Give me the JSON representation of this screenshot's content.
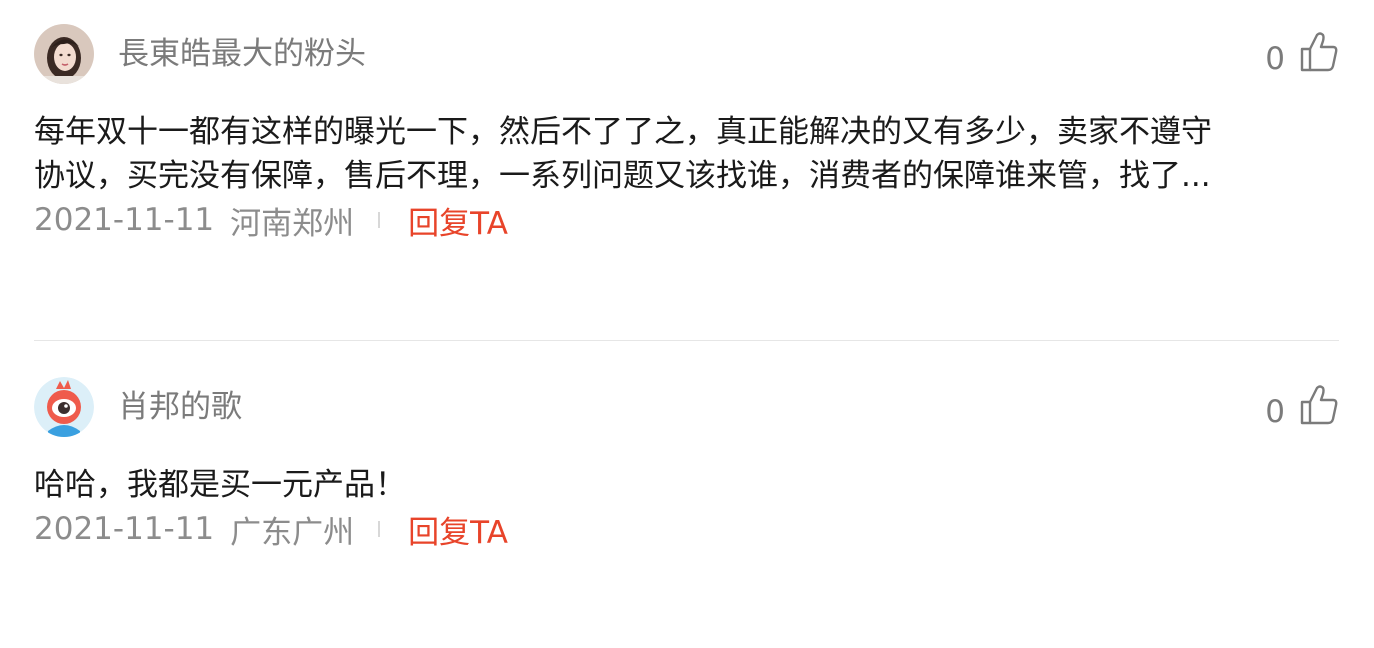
{
  "comments": [
    {
      "username": "長東皓最大的粉头",
      "avatar": "user-photo-avatar",
      "likes": "0",
      "text_line1": "每年双十一都有这样的曝光一下，然后不了了之，真正能解决的又有多少，卖家不遵守",
      "text_line2": "协议，买完没有保障，售后不理，一系列问题又该找谁，消费者的保障谁来管，找了...",
      "date": "2021-11-11",
      "location": "河南郑州",
      "reply_label": "回复TA"
    },
    {
      "username": "肖邦的歌",
      "avatar": "weibo-eye-avatar",
      "likes": "0",
      "text": "哈哈，我都是买一元产品！",
      "date": "2021-11-11",
      "location": "广东广州",
      "reply_label": "回复TA"
    }
  ],
  "colors": {
    "reply": "#e8442a",
    "meta": "#8c8c8c",
    "username": "#7b7b7b",
    "body": "#1a1a1a",
    "divider": "#e6e6e6"
  },
  "icons": {
    "like": "thumbs-up-icon"
  }
}
